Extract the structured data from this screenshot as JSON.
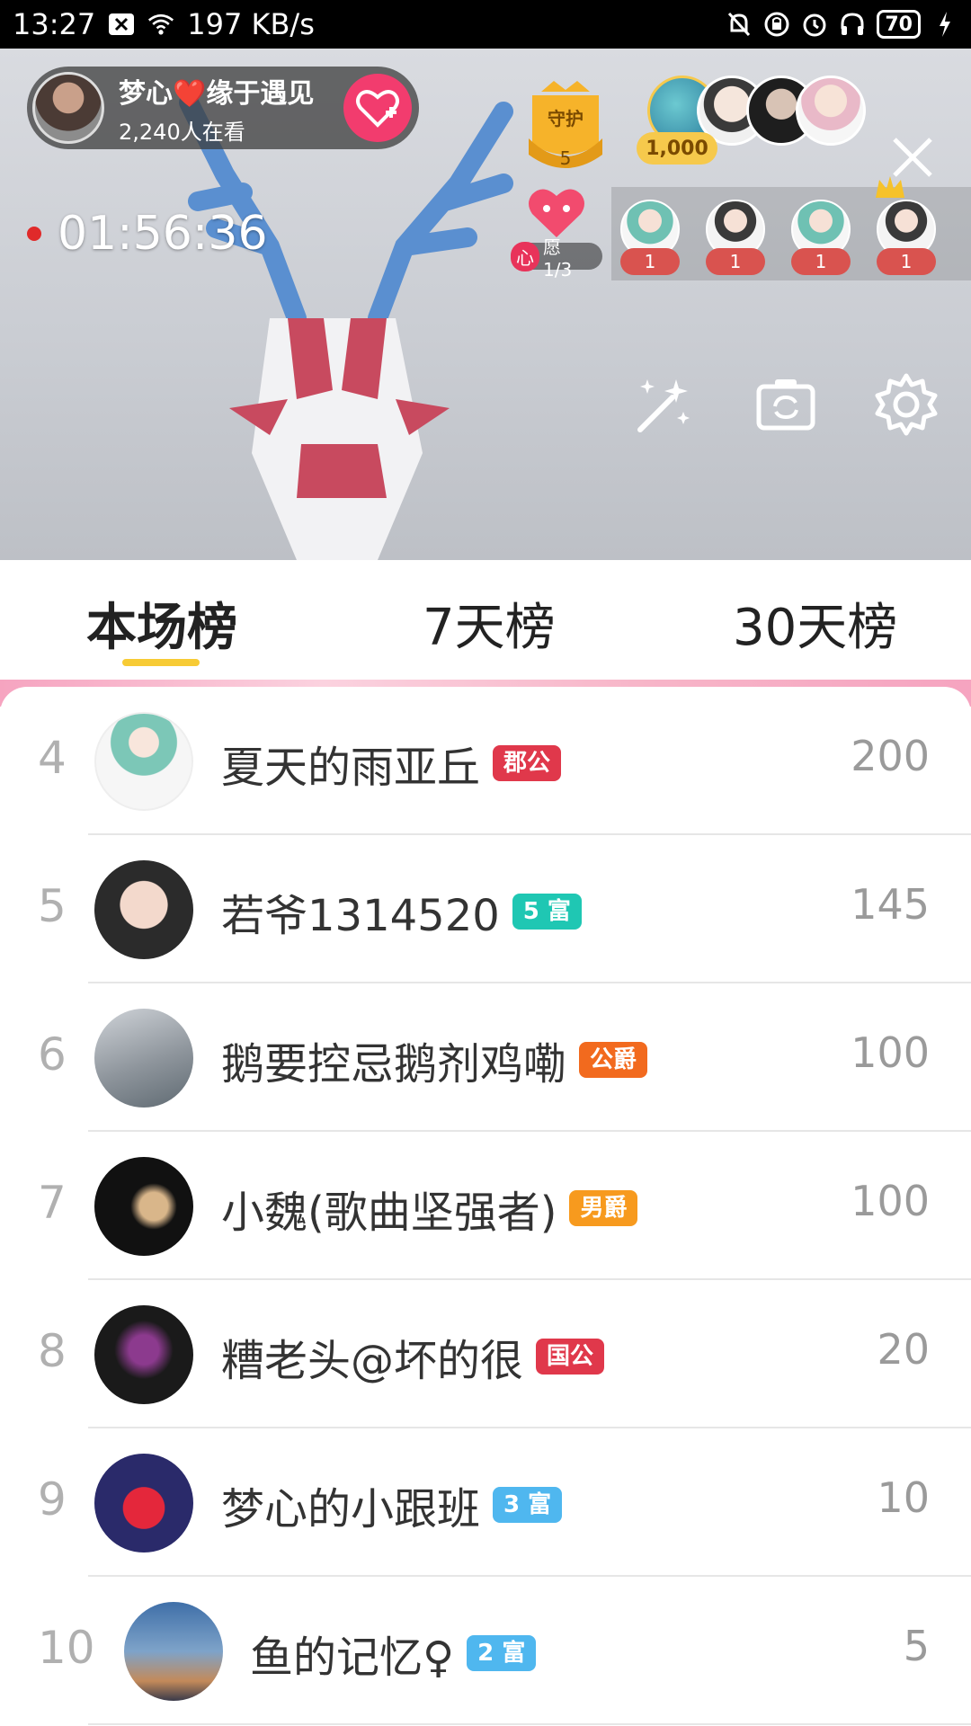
{
  "status_bar": {
    "time": "13:27",
    "net_speed": "197 KB/s",
    "battery": "70"
  },
  "live": {
    "host_name": "梦心❤️缘于遇见",
    "viewers": "2,240人在看",
    "guard_label": "守护",
    "guard_count": "5",
    "top_coin": "1,000",
    "timer": "01:56:36",
    "wish_prefix": "心",
    "wish_label": "愿 1/3",
    "wish_counts": [
      "1",
      "1",
      "1",
      "1"
    ]
  },
  "tabs": [
    {
      "label": "本场榜"
    },
    {
      "label": "7天榜"
    },
    {
      "label": "30天榜"
    }
  ],
  "rows": [
    {
      "rank": "4",
      "name": "夏天的雨亚丘",
      "badge": "郡公",
      "badge_color": "#e0384b",
      "score": "200"
    },
    {
      "rank": "5",
      "name": "若爷1314520",
      "badge": "5 富",
      "badge_color": "#1fc7b3",
      "score": "145"
    },
    {
      "rank": "6",
      "name": "鹅要控忌鹅剂鸡嘞",
      "badge": "公爵",
      "badge_color": "#f26a1e",
      "score": "100"
    },
    {
      "rank": "7",
      "name": "小魏(歌曲坚强者)",
      "badge": "男爵",
      "badge_color": "#f79a1e",
      "score": "100"
    },
    {
      "rank": "8",
      "name": "糟老头@坏的很",
      "badge": "国公",
      "badge_color": "#e0384b",
      "score": "20"
    },
    {
      "rank": "9",
      "name": "梦心的小跟班",
      "badge": "3 富",
      "badge_color": "#4fb7ef",
      "score": "10"
    },
    {
      "rank": "10",
      "name": "鱼的记忆♀",
      "badge": "2 富",
      "badge_color": "#4fb7ef",
      "score": "5"
    }
  ],
  "icons": {
    "magic": "magic-wand-icon",
    "camera": "camera-switch-icon",
    "settings": "gear-icon",
    "close": "close-icon"
  }
}
